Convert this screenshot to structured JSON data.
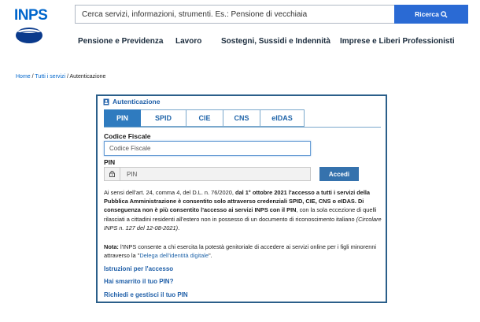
{
  "header": {
    "logo_text": "INPS",
    "search": {
      "placeholder": "Cerca servizi, informazioni, strumenti. Es.: Pensione di vecchiaia",
      "button_label": "Ricerca"
    }
  },
  "nav": {
    "items": [
      {
        "label": "Pensione e Previdenza"
      },
      {
        "label": "Lavoro"
      },
      {
        "label": "Sostegni, Sussidi e Indennità"
      },
      {
        "label": "Imprese e Liberi Professionisti"
      }
    ]
  },
  "breadcrumb": {
    "home": "Home",
    "all_services": "Tutti i servizi",
    "separator": " / ",
    "current": "Autenticazione"
  },
  "auth": {
    "title": "Autenticazione",
    "tabs": [
      {
        "label": "PIN",
        "active": true
      },
      {
        "label": "SPID",
        "active": false
      },
      {
        "label": "CIE",
        "active": false
      },
      {
        "label": "CNS",
        "active": false
      },
      {
        "label": "eIDAS",
        "active": false
      }
    ],
    "codice_fiscale_label": "Codice Fiscale",
    "codice_fiscale_placeholder": "Codice Fiscale",
    "pin_label": "PIN",
    "pin_placeholder": "PIN",
    "accedi_label": "Accedi",
    "notice": {
      "part1": "Ai sensi dell'art. 24, comma 4, del D.L. n. 76/2020, ",
      "bold": "dal 1° ottobre 2021 l'accesso a tutti i servizi della Pubblica Amministrazione è consentito solo attraverso credenziali SPID, CIE, CNS o eIDAS. Di conseguenza non è più consentito l'accesso ai servizi INPS con il PIN",
      "part2": ", con la sola eccezione di quelli rilasciati a cittadini residenti all'estero non in possesso di un documento di riconoscimento italiano ",
      "italic": "(Circolare INPS n. 127 del 12-08-2021)",
      "end": "."
    },
    "note": {
      "label": "Nota:",
      "text": " l'INPS consente a chi esercita la potestà genitoriale di accedere ai servizi online per i figli minorenni attraverso la \"",
      "link": "Delega dell'identità digitale",
      "end": "\"."
    },
    "links": [
      {
        "label": "Istruzioni per l'accesso"
      },
      {
        "label": "Hai smarrito il tuo PIN?"
      },
      {
        "label": "Richiedi e gestisci il tuo PIN"
      }
    ]
  },
  "colors": {
    "brand_blue": "#0066cc",
    "button_blue": "#2a6ad4",
    "tab_active": "#2f7bbf",
    "panel_border": "#2b5f8a"
  }
}
